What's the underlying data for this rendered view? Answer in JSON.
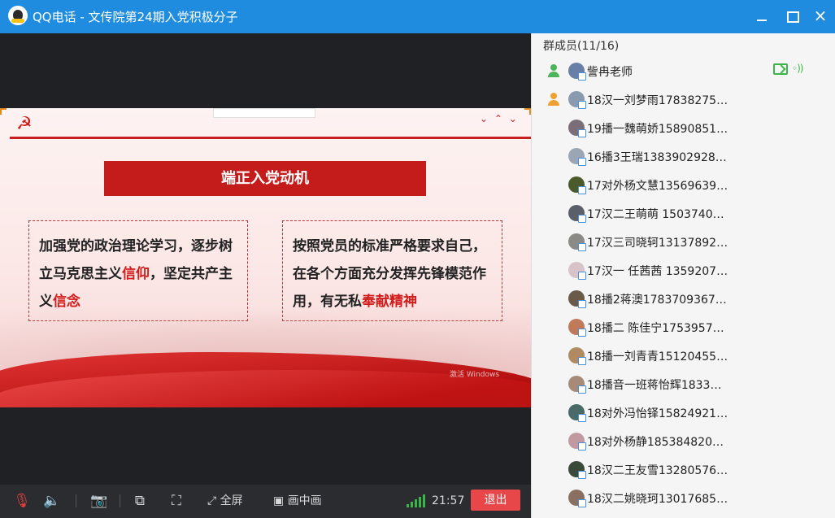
{
  "window": {
    "title": "QQ电话 - 文传院第24期入党积极分子",
    "buttons": {
      "minimize": "minimize",
      "maximize": "maximize",
      "close": "×"
    }
  },
  "slide": {
    "heading": "端正入党动机",
    "left_box": {
      "text1": "加强党的政治理论学习，逐步树立马克思主义",
      "hl1": "信仰",
      "text2": "，坚定共产主义",
      "hl2": "信念"
    },
    "right_box": {
      "text1": "按照党员的标准严格要求自己，在各个方面充分发挥先锋模范作用，有无私",
      "hl1": "奉献精神"
    },
    "watermark": "激活 Windows"
  },
  "toolbar": {
    "fullscreen_label": "全屏",
    "pip_label": "画中画",
    "time": "21:57",
    "exit_label": "退出"
  },
  "members": {
    "header": "群成员(11/16)",
    "list": [
      {
        "name": "訾冉老师",
        "role": "green",
        "sharing": true,
        "avatar": "#6a7fa8"
      },
      {
        "name": "18汉一刘梦雨17838275…",
        "role": "orange",
        "sharing": false,
        "avatar": "#8a9bb0"
      },
      {
        "name": "19播一魏萌娇15890851…",
        "role": "",
        "sharing": false,
        "avatar": "#7a6f78"
      },
      {
        "name": "16播3王瑞1383902928…",
        "role": "",
        "sharing": false,
        "avatar": "#9aa6b4"
      },
      {
        "name": "17对外杨文慧13569639…",
        "role": "",
        "sharing": false,
        "avatar": "#4a5a2a"
      },
      {
        "name": "17汉二王萌萌 1503740…",
        "role": "",
        "sharing": false,
        "avatar": "#5a5f6a"
      },
      {
        "name": "17汉三司晓轲13137892…",
        "role": "",
        "sharing": false,
        "avatar": "#8c8a86"
      },
      {
        "name": "17汉一 任茜茜 1359207…",
        "role": "",
        "sharing": false,
        "avatar": "#d8c4c8"
      },
      {
        "name": "18播2蒋澳1783709367…",
        "role": "",
        "sharing": false,
        "avatar": "#6a5a48"
      },
      {
        "name": "18播二 陈佳宁1753957…",
        "role": "",
        "sharing": false,
        "avatar": "#c07a5a"
      },
      {
        "name": "18播一刘青青15120455…",
        "role": "",
        "sharing": false,
        "avatar": "#b08a60"
      },
      {
        "name": "18播音一班蒋怡辉1833…",
        "role": "",
        "sharing": false,
        "avatar": "#a88a78"
      },
      {
        "name": "18对外冯怡铎15824921…",
        "role": "",
        "sharing": false,
        "avatar": "#4a6a68"
      },
      {
        "name": "18对外杨静1853848208…",
        "role": "",
        "sharing": false,
        "avatar": "#c09aa0"
      },
      {
        "name": "18汉二王友雪13280576…",
        "role": "",
        "sharing": false,
        "avatar": "#3a4a3a"
      },
      {
        "name": "18汉二姚晓珂13017685…",
        "role": "",
        "sharing": false,
        "avatar": "#8a7060"
      }
    ]
  },
  "icons": {
    "mic": "muted-mic-icon",
    "speaker": "speaker-icon",
    "camera": "camera-off-icon",
    "share": "screen-share-icon",
    "whiteboard": "presenter-icon",
    "fullscreen": "fullscreen-icon",
    "pip": "picture-in-picture-icon",
    "signal": "signal-strength-icon"
  },
  "colors": {
    "titlebar": "#1f8ce0",
    "exit": "#e8474a",
    "slide_red": "#c41b1b",
    "signal": "#3bb54a"
  }
}
